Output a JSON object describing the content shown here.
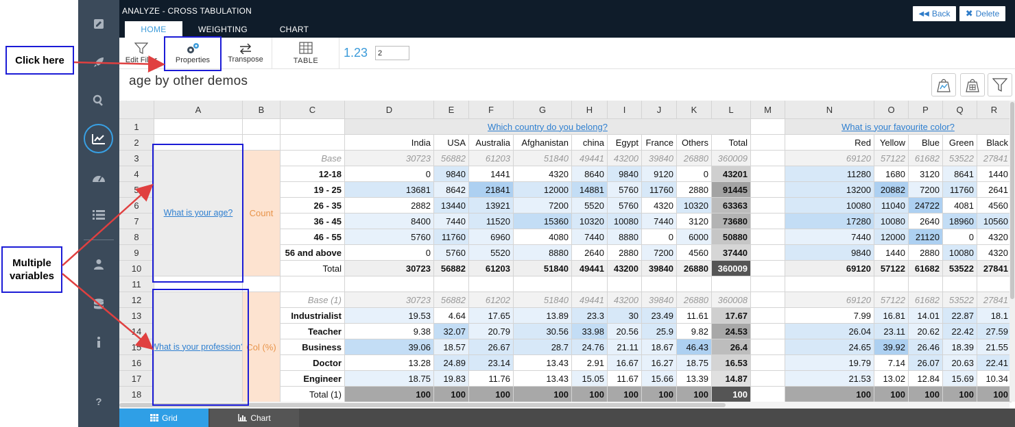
{
  "app": {
    "title": "ANALYZE - CROSS TABULATION",
    "tabs": [
      "HOME",
      "WEIGHTING",
      "CHART"
    ],
    "back_label": "Back",
    "delete_label": "Delete"
  },
  "ribbon": {
    "edit_filter": "Edit Filter",
    "properties": "Properties",
    "transpose": "Transpose",
    "table": "TABLE",
    "decimal_label": "1.23",
    "decimal_value": "2"
  },
  "page_title": "age by other demos",
  "annotations": {
    "click_here": "Click here",
    "multiple_variables": "Multiple variables"
  },
  "grid": {
    "columns": [
      "A",
      "B",
      "C",
      "D",
      "E",
      "F",
      "G",
      "H",
      "I",
      "J",
      "K",
      "L",
      "M",
      "N",
      "O",
      "P",
      "Q",
      "R"
    ],
    "rows": [
      "1",
      "2",
      "3",
      "4",
      "5",
      "6",
      "7",
      "8",
      "9",
      "10",
      "11",
      "12",
      "13",
      "14",
      "15",
      "16",
      "17",
      "18"
    ],
    "question_country": "Which country do you belong?",
    "question_color": "What is your favourite color?",
    "country_headers": [
      "India",
      "USA",
      "Australia",
      "Afghanistan",
      "china",
      "Egypt",
      "France",
      "Others",
      "Total"
    ],
    "color_headers": [
      "Red",
      "Yellow",
      "Blue",
      "Green",
      "Black"
    ],
    "age_var": "What is your age?",
    "age_stat": "Count",
    "age_rows": [
      {
        "label": "Base",
        "country": [
          "30723",
          "56882",
          "61203",
          "51840",
          "49441",
          "43200",
          "39840",
          "26880",
          "360009"
        ],
        "color": [
          "69120",
          "57122",
          "61682",
          "53522",
          "27841"
        ]
      },
      {
        "label": "12-18",
        "country": [
          "0",
          "9840",
          "1441",
          "4320",
          "8640",
          "9840",
          "9120",
          "0",
          "43201"
        ],
        "color": [
          "11280",
          "1680",
          "3120",
          "8641",
          "1440"
        ]
      },
      {
        "label": "19 - 25",
        "country": [
          "13681",
          "8642",
          "21841",
          "12000",
          "14881",
          "5760",
          "11760",
          "2880",
          "91445"
        ],
        "color": [
          "13200",
          "20882",
          "7200",
          "11760",
          "2641"
        ]
      },
      {
        "label": "26 - 35",
        "country": [
          "2882",
          "13440",
          "13921",
          "7200",
          "5520",
          "5760",
          "4320",
          "10320",
          "63363"
        ],
        "color": [
          "10080",
          "11040",
          "24722",
          "4081",
          "4560"
        ]
      },
      {
        "label": "36 - 45",
        "country": [
          "8400",
          "7440",
          "11520",
          "15360",
          "10320",
          "10080",
          "7440",
          "3120",
          "73680"
        ],
        "color": [
          "17280",
          "10080",
          "2640",
          "18960",
          "10560"
        ]
      },
      {
        "label": "46 - 55",
        "country": [
          "5760",
          "11760",
          "6960",
          "4080",
          "7440",
          "8880",
          "0",
          "6000",
          "50880"
        ],
        "color": [
          "7440",
          "12000",
          "21120",
          "0",
          "4320"
        ]
      },
      {
        "label": "56 and above",
        "country": [
          "0",
          "5760",
          "5520",
          "8880",
          "2640",
          "2880",
          "7200",
          "4560",
          "37440"
        ],
        "color": [
          "9840",
          "1440",
          "2880",
          "10080",
          "4320"
        ]
      },
      {
        "label": "Total",
        "country": [
          "30723",
          "56882",
          "61203",
          "51840",
          "49441",
          "43200",
          "39840",
          "26880",
          "360009"
        ],
        "color": [
          "69120",
          "57122",
          "61682",
          "53522",
          "27841"
        ]
      }
    ],
    "prof_var": "What is your profession?",
    "prof_stat": "Col (%)",
    "prof_rows": [
      {
        "label": "Base (1)",
        "country": [
          "30723",
          "56882",
          "61202",
          "51840",
          "49441",
          "43200",
          "39840",
          "26880",
          "360008"
        ],
        "color": [
          "69120",
          "57122",
          "61682",
          "53522",
          "27841"
        ]
      },
      {
        "label": "Industrialist",
        "country": [
          "19.53",
          "4.64",
          "17.65",
          "13.89",
          "23.3",
          "30",
          "23.49",
          "11.61",
          "17.67"
        ],
        "color": [
          "7.99",
          "16.81",
          "14.01",
          "22.87",
          "18.1"
        ]
      },
      {
        "label": "Teacher",
        "country": [
          "9.38",
          "32.07",
          "20.79",
          "30.56",
          "33.98",
          "20.56",
          "25.9",
          "9.82",
          "24.53"
        ],
        "color": [
          "26.04",
          "23.11",
          "20.62",
          "22.42",
          "27.59"
        ]
      },
      {
        "label": "Business",
        "country": [
          "39.06",
          "18.57",
          "26.67",
          "28.7",
          "24.76",
          "21.11",
          "18.67",
          "46.43",
          "26.4"
        ],
        "color": [
          "24.65",
          "39.92",
          "26.46",
          "18.39",
          "21.55"
        ]
      },
      {
        "label": "Doctor",
        "country": [
          "13.28",
          "24.89",
          "23.14",
          "13.43",
          "2.91",
          "16.67",
          "16.27",
          "18.75",
          "16.53"
        ],
        "color": [
          "19.79",
          "7.14",
          "26.07",
          "20.63",
          "22.41"
        ]
      },
      {
        "label": "Engineer",
        "country": [
          "18.75",
          "19.83",
          "11.76",
          "13.43",
          "15.05",
          "11.67",
          "15.66",
          "13.39",
          "14.87"
        ],
        "color": [
          "21.53",
          "13.02",
          "12.84",
          "15.69",
          "10.34"
        ]
      },
      {
        "label": "Total (1)",
        "country": [
          "100",
          "100",
          "100",
          "100",
          "100",
          "100",
          "100",
          "100",
          "100"
        ],
        "color": [
          "100",
          "100",
          "100",
          "100",
          "100"
        ]
      }
    ]
  },
  "bottom_tabs": {
    "grid": "Grid",
    "chart": "Chart"
  },
  "colors": {
    "accent": "#3a9ad9",
    "topbar": "#0f1c2a",
    "rail": "#3b4a5a",
    "callout_border": "#1b1bd6",
    "arrow": "#e04040",
    "stat_cell": "#fde3d0"
  }
}
